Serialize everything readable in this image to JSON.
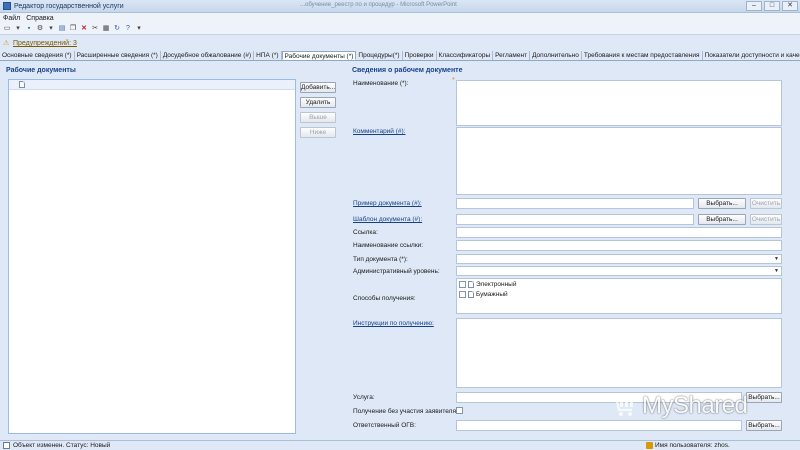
{
  "window": {
    "title": "Редактор государственной услуги",
    "caption_center": "...обучение_реестр по и процедур - Microsoft PowerPoint",
    "minimize": "–",
    "maximize": "□",
    "close": "✕"
  },
  "menu": {
    "file": "Файл",
    "help": "Справка"
  },
  "warnings": {
    "link": "Предупреждений: 3"
  },
  "tabs": [
    "Основные сведения (*)",
    "Расширенные сведения (*)",
    "Досудебное обжалование (#)",
    "НПА (*)",
    "Рабочие документы (*)",
    "Процедуры(*)",
    "Проверки",
    "Классификаторы",
    "Регламент",
    "Дополнительно",
    "Требования к местам предоставления",
    "Показатели доступности и качества"
  ],
  "left_panel": {
    "header": "Рабочие документы",
    "buttons": {
      "add": "Добавить...",
      "remove": "Удалить",
      "up": "Выше",
      "down": "Ниже"
    }
  },
  "right_panel": {
    "header": "Сведения о рабочем документе",
    "labels": {
      "name": "Наименование (*):",
      "comment": "Комментарий (#):",
      "example": "Пример документа (#):",
      "template": "Шаблон документа (#):",
      "link": "Ссылка:",
      "link_name": "Наименование ссылки:",
      "doc_type": "Тип документа (*):",
      "admin_level": "Административный уровень:",
      "methods": "Способы получения:",
      "instructions": "Инструкции по получению:",
      "service": "Услуга:",
      "without_applicant": "Получение без участия заявителя:",
      "responsible": "Ответственный ОГВ:"
    },
    "choose": "Выбрать...",
    "clear": "Очистить",
    "methods_options": [
      "Электронный",
      "Бумажный"
    ]
  },
  "status": {
    "text": "Объект изменен. Статус: Новый",
    "user": "Имя пользователя: zhos."
  },
  "watermark": {
    "text": "MyShared"
  }
}
